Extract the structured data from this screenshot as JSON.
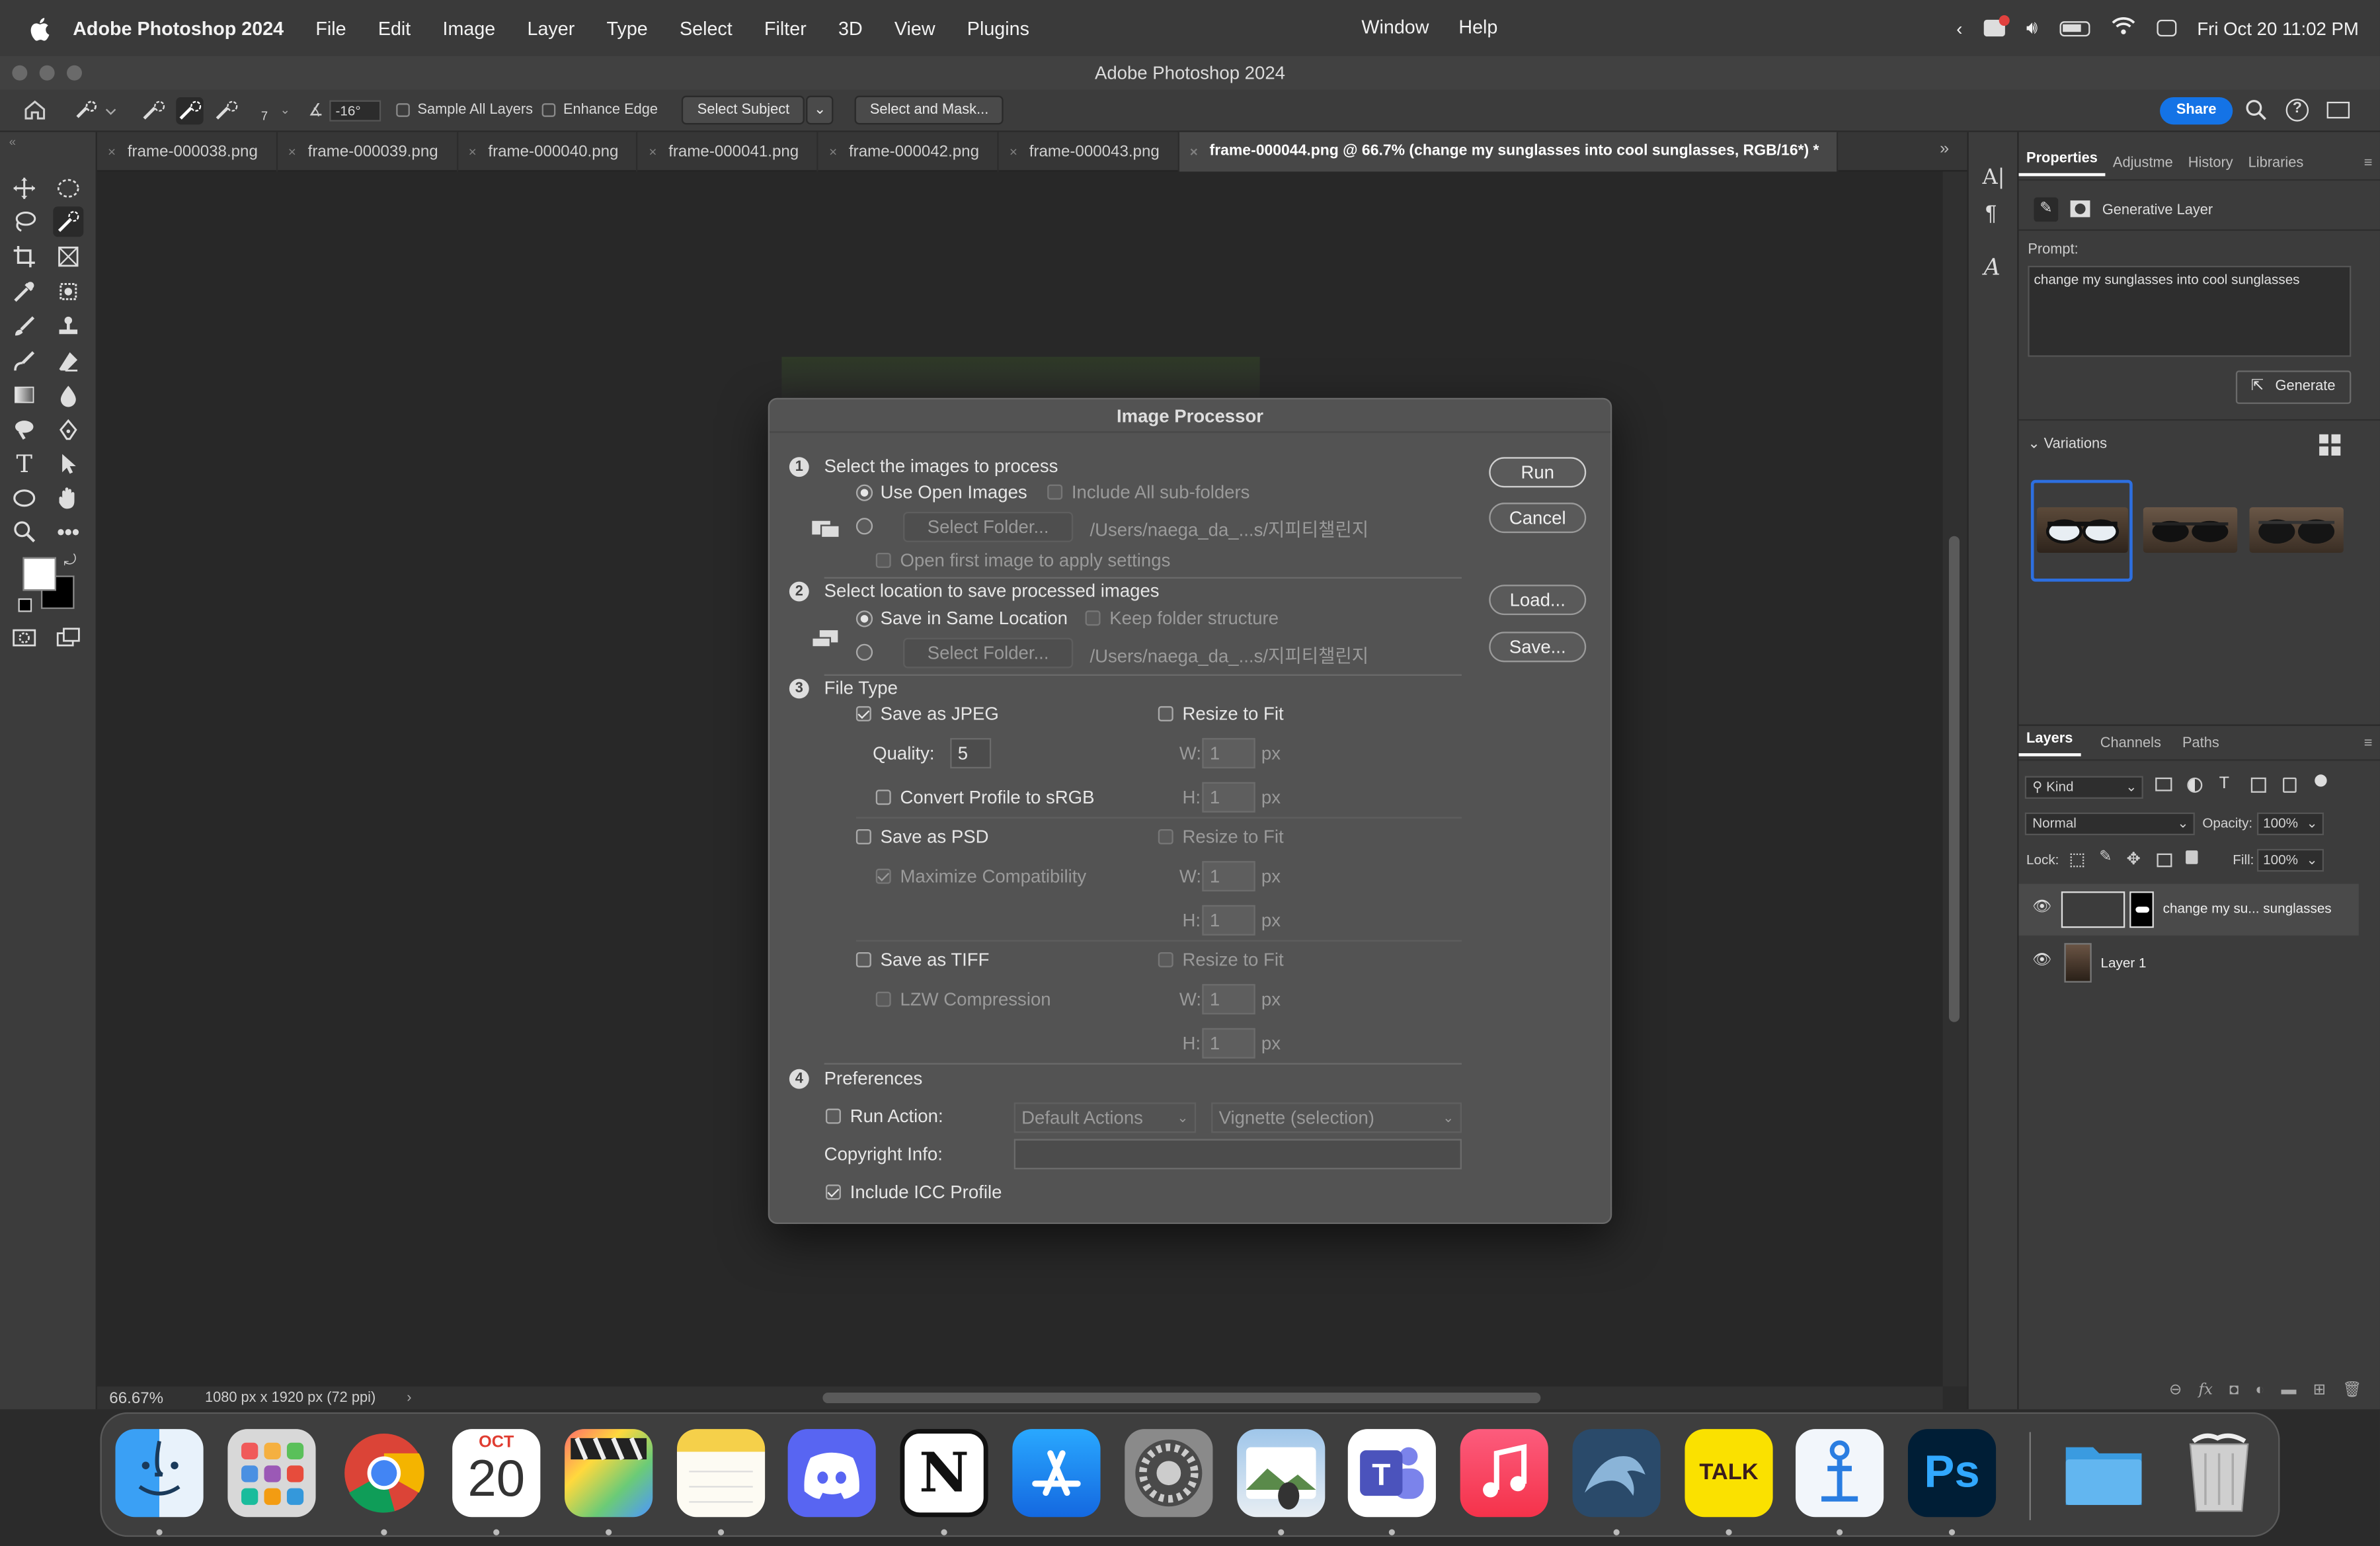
{
  "menubar": {
    "app_name": "Adobe Photoshop 2024",
    "items": [
      "File",
      "Edit",
      "Image",
      "Layer",
      "Type",
      "Select",
      "Filter",
      "3D",
      "View",
      "Plugins"
    ],
    "items_right": [
      "Window",
      "Help"
    ],
    "clock": "Fri Oct 20  11:02 PM"
  },
  "window": {
    "title": "Adobe Photoshop 2024"
  },
  "options_bar": {
    "brush_size": "7",
    "angle": "-16°",
    "sample_all_layers": "Sample All Layers",
    "enhance_edge": "Enhance Edge",
    "select_subject": "Select Subject",
    "select_and_mask": "Select and Mask...",
    "share": "Share"
  },
  "tabs": [
    {
      "label": "frame-000038.png"
    },
    {
      "label": "frame-000039.png"
    },
    {
      "label": "frame-000040.png"
    },
    {
      "label": "frame-000041.png"
    },
    {
      "label": "frame-000042.png"
    },
    {
      "label": "frame-000043.png"
    },
    {
      "label": "frame-000044.png @ 66.7% (change my sunglasses into cool sunglasses, RGB/16*) *"
    }
  ],
  "status": {
    "zoom": "66.67%",
    "doc_info": "1080 px x 1920 px (72 ppi)"
  },
  "properties": {
    "tabs": [
      "Properties",
      "Adjustme",
      "History",
      "Libraries"
    ],
    "layer_type": "Generative Layer",
    "prompt_label": "Prompt:",
    "prompt_text": "change my sunglasses into cool sunglasses",
    "generate": "Generate",
    "variations": "Variations"
  },
  "layers": {
    "tabs": [
      "Layers",
      "Channels",
      "Paths"
    ],
    "kind": "Kind",
    "blend_mode": "Normal",
    "opacity_label": "Opacity:",
    "opacity": "100%",
    "lock_label": "Lock:",
    "fill_label": "Fill:",
    "fill": "100%",
    "rows": [
      {
        "name": "change my su... sunglasses"
      },
      {
        "name": "Layer 1"
      }
    ]
  },
  "dialog": {
    "title": "Image Processor",
    "s1": {
      "num": "1",
      "label": "Select the images to process",
      "use_open": "Use Open Images",
      "include_sub": "Include All sub-folders",
      "select_folder": "Select Folder...",
      "path": "/Users/naega_da_...s/지피티챌린지",
      "open_first": "Open first image to apply settings"
    },
    "s2": {
      "num": "2",
      "label": "Select location to save processed images",
      "same_loc": "Save in Same Location",
      "keep_struct": "Keep folder structure",
      "select_folder": "Select Folder...",
      "path": "/Users/naega_da_...s/지피티챌린지"
    },
    "s3": {
      "num": "3",
      "label": "File Type",
      "save_jpeg": "Save as JPEG",
      "resize_fit": "Resize to Fit",
      "quality_label": "Quality:",
      "quality": "5",
      "w": "W:",
      "h": "H:",
      "one": "1",
      "px": "px",
      "convert": "Convert Profile to sRGB",
      "save_psd": "Save as PSD",
      "max_compat": "Maximize Compatibility",
      "save_tiff": "Save as TIFF",
      "lzw": "LZW Compression"
    },
    "s4": {
      "num": "4",
      "label": "Preferences",
      "run_action": "Run Action:",
      "default_actions": "Default Actions",
      "vignette": "Vignette (selection)",
      "copyright": "Copyright Info:",
      "icc": "Include ICC Profile"
    },
    "buttons": {
      "run": "Run",
      "cancel": "Cancel",
      "load": "Load...",
      "save": "Save..."
    }
  },
  "dock": {
    "calendar_month": "OCT",
    "calendar_day": "20",
    "talk": "TALK",
    "ps": "Ps",
    "notion": "N"
  }
}
